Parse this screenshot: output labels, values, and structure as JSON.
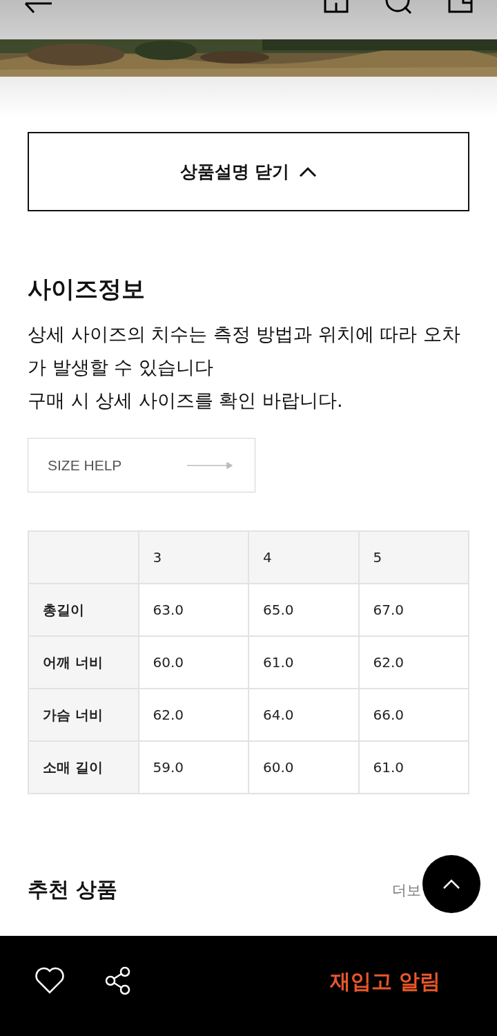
{
  "collapse_button": {
    "label": "상품설명 닫기",
    "expanded": true
  },
  "size_info": {
    "title": "사이즈정보",
    "notes": [
      "상세 사이즈의 치수는 측정 방법과 위치에 따라 오차가 발생할 수 있습니다",
      "구매 시 상세 사이즈를 확인 바랍니다."
    ],
    "help_button": "SIZE HELP"
  },
  "size_table": {
    "columns": [
      "3",
      "4",
      "5"
    ],
    "rows": [
      {
        "label": "총길이",
        "values": [
          "63.0",
          "65.0",
          "67.0"
        ]
      },
      {
        "label": "어깨 너비",
        "values": [
          "60.0",
          "61.0",
          "62.0"
        ]
      },
      {
        "label": "가슴 너비",
        "values": [
          "62.0",
          "64.0",
          "66.0"
        ]
      },
      {
        "label": "소매 길이",
        "values": [
          "59.0",
          "60.0",
          "61.0"
        ]
      }
    ]
  },
  "recommended": {
    "title": "추천 상품",
    "more_link": "더보"
  },
  "bottom_bar": {
    "liked": false,
    "restock_button": "재입고 알림"
  }
}
